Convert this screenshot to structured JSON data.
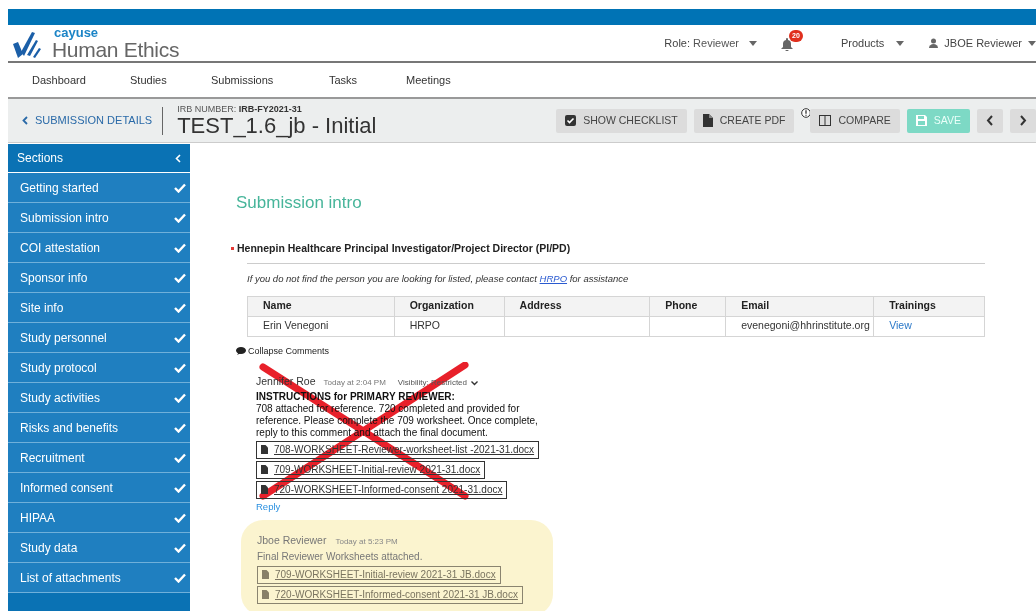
{
  "header": {
    "logo": {
      "brand": "cayuse",
      "product": "Human Ethics"
    },
    "role": {
      "label": "Role:",
      "value": "Reviewer"
    },
    "notifications": {
      "count": "20"
    },
    "products": "Products",
    "user": "JBOE Reviewer"
  },
  "nav": [
    {
      "label": "Dashboard"
    },
    {
      "label": "Studies"
    },
    {
      "label": "Submissions"
    },
    {
      "label": "Tasks"
    },
    {
      "label": "Meetings"
    }
  ],
  "subheader": {
    "back_link": "SUBMISSION DETAILS",
    "irb_label": "IRB NUMBER:",
    "irb_number": "IRB-FY2021-31",
    "title": "TEST_1.6_jb - Initial",
    "actions": [
      {
        "kind": "checklist",
        "label": "SHOW CHECKLIST",
        "disabled": false
      },
      {
        "kind": "pdf",
        "label": "CREATE PDF",
        "disabled": false
      },
      {
        "kind": "compare",
        "label": "COMPARE",
        "disabled": false
      },
      {
        "kind": "save",
        "label": "SAVE",
        "disabled": true
      },
      {
        "kind": "prev"
      },
      {
        "kind": "next"
      }
    ]
  },
  "sidebar": {
    "title": "Sections",
    "items": [
      {
        "label": "Getting started",
        "complete": true
      },
      {
        "label": "Submission intro",
        "complete": true
      },
      {
        "label": "COI attestation",
        "complete": true
      },
      {
        "label": "Sponsor info",
        "complete": true
      },
      {
        "label": "Site info",
        "complete": true
      },
      {
        "label": "Study personnel",
        "complete": true
      },
      {
        "label": "Study protocol",
        "complete": true
      },
      {
        "label": "Study activities",
        "complete": true
      },
      {
        "label": "Risks and benefits",
        "complete": true
      },
      {
        "label": "Recruitment",
        "complete": true
      },
      {
        "label": "Informed consent",
        "complete": true
      },
      {
        "label": "HIPAA",
        "complete": true
      },
      {
        "label": "Study data",
        "complete": true
      },
      {
        "label": "List of attachments",
        "complete": true
      }
    ]
  },
  "content": {
    "section_title": "Submission intro",
    "field": {
      "label": "Hennepin Healthcare Principal Investigator/Project Director (PI/PD)",
      "required": true,
      "note_before": "If you do not find the person you are looking for listed, please contact",
      "note_link": "HRPO",
      "note_after": "for assistance",
      "table": {
        "columns": [
          "Name",
          "Organization",
          "Address",
          "Phone",
          "Email",
          "Trainings"
        ],
        "rows": [
          [
            "Erin Venegoni",
            "HRPO",
            "",
            "",
            "evenegoni@hhrinstitute.org",
            "View"
          ]
        ]
      }
    },
    "collapse_comments": "Collapse Comments",
    "comment": {
      "author": "Jennifer Roe",
      "time": "Today at 2:04 PM",
      "visibility": "Visibility: Restricted",
      "heading": "INSTRUCTIONS for PRIMARY REVIEWER:",
      "text": "708 attached for reference. 720 completed and provided for reference. Please complete the 709 worksheet. Once complete, reply to this comment and attach the final document.",
      "attachments": [
        "708-WORKSHEET-Reviewer-worksheet-list -2021-31.docx",
        "709-WORKSHEET-Initial-review 2021-31.docx",
        "720-WORKSHEET-Informed-consent 2021-31.docx"
      ],
      "reply": "Reply",
      "crossed_out": true,
      "replies": [
        {
          "author": "Jboe Reviewer",
          "time": "Today at 5:23 PM",
          "text": "Final Reviewer Worksheets attached.",
          "attachments": [
            "709-WORKSHEET-Initial-review 2021-31 JB.docx",
            "720-WORKSHEET-Informed-consent 2021-31 JB.docx"
          ]
        }
      ]
    }
  }
}
